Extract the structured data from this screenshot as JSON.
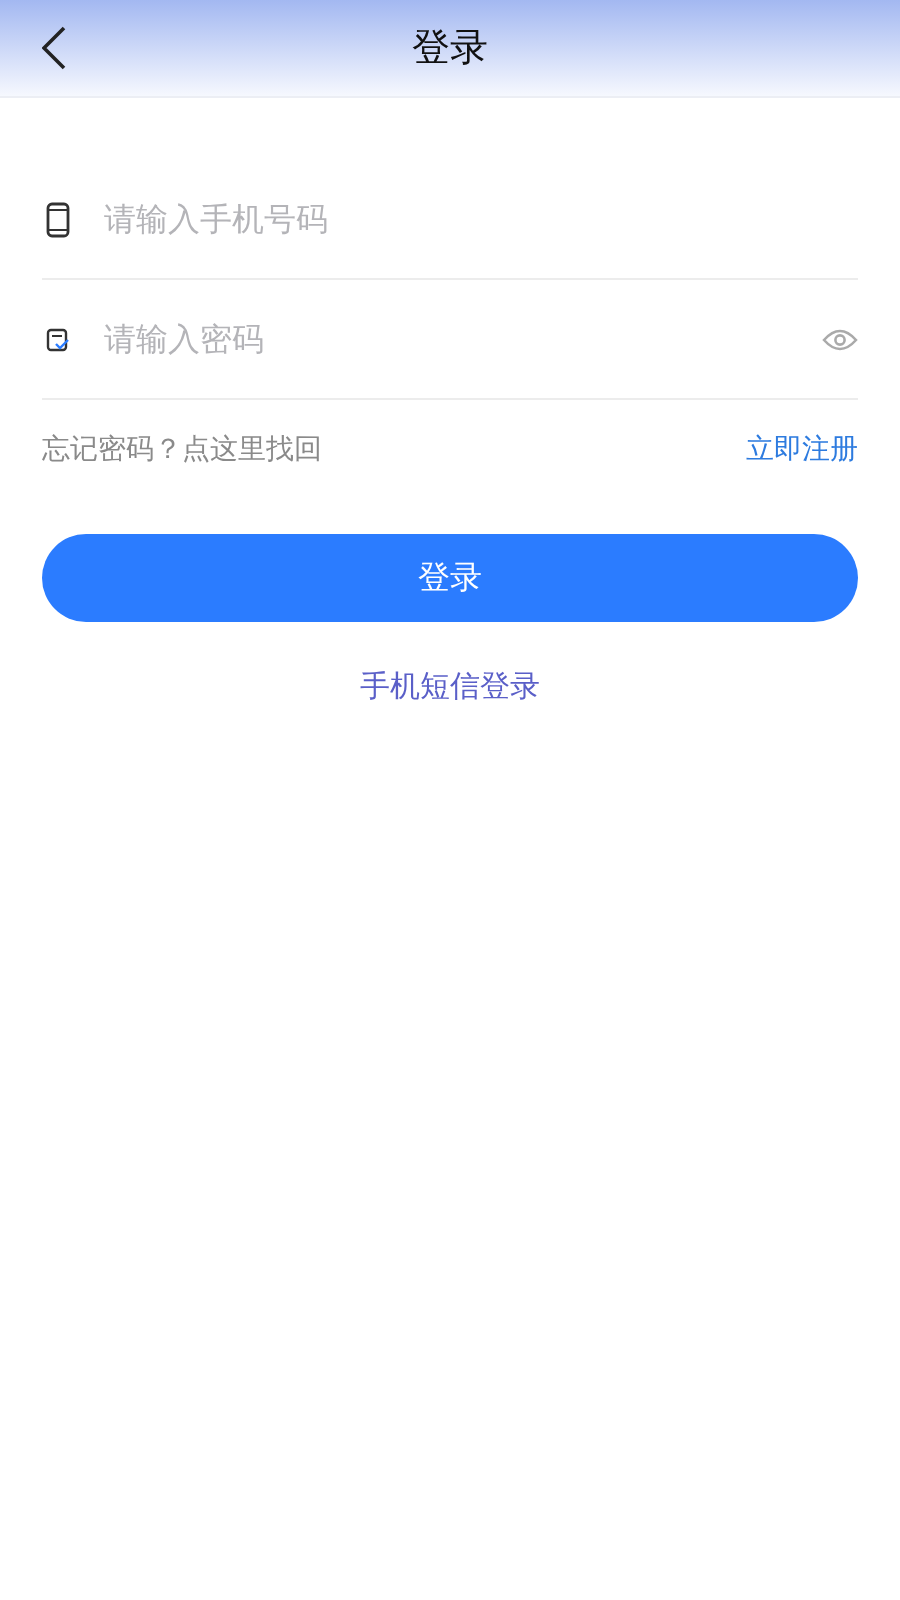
{
  "header": {
    "title": "登录"
  },
  "fields": [
    {
      "kind": "phone",
      "placeholder": "请输入手机号码"
    },
    {
      "kind": "password",
      "placeholder": "请输入密码"
    }
  ],
  "forgot_link": "忘记密码？点这里找回",
  "register_link": "立即注册",
  "login_button": "登录",
  "sms_login_link": "手机短信登录"
}
